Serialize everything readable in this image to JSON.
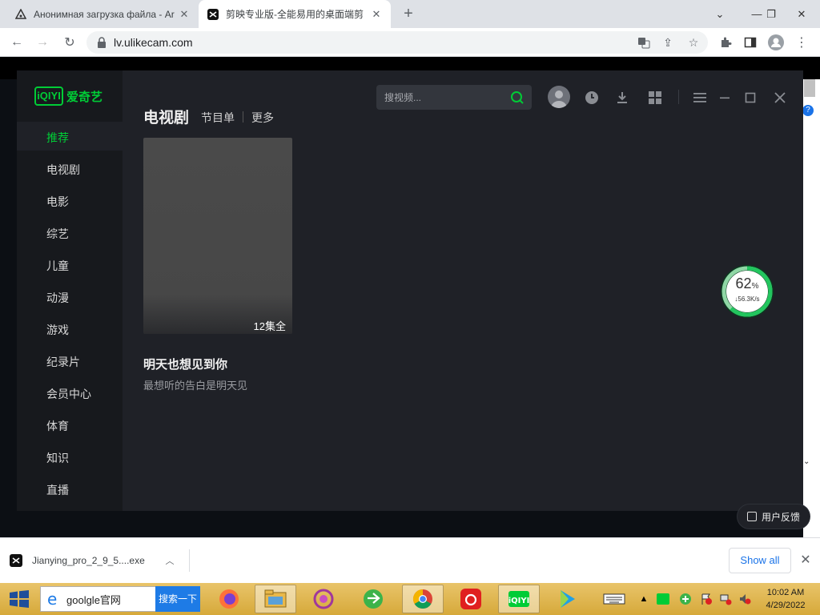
{
  "browser": {
    "tabs": [
      {
        "title": "Анонимная загрузка файла - Ar",
        "active": false
      },
      {
        "title": "剪映专业版-全能易用的桌面端剪",
        "active": true
      }
    ],
    "url": "lv.ulikecam.com"
  },
  "app": {
    "name": "爱奇艺",
    "logo_text": "iQIYI",
    "search_placeholder": "搜视频...",
    "nav": [
      "推荐",
      "电视剧",
      "电影",
      "综艺",
      "儿童",
      "动漫",
      "游戏",
      "纪录片",
      "会员中心",
      "体育",
      "知识",
      "直播"
    ],
    "active_nav": "推荐",
    "section": {
      "title": "电视剧",
      "links": [
        "节目单",
        "更多"
      ]
    },
    "card": {
      "title": "明天也想见到你",
      "subtitle": "最想听的告白是明天见",
      "episode_badge": "12集全"
    }
  },
  "speed_widget": {
    "percent": "62",
    "percent_sign": "%",
    "rate": "↓56.3K/s",
    "fraction": 0.62
  },
  "feedback": {
    "label": "用户反馈"
  },
  "download_bar": {
    "file": "Jianying_pro_2_9_5....exe",
    "show_all": "Show all"
  },
  "taskbar": {
    "search_text": "goolgle官网",
    "search_button": "搜索一下",
    "time": "10:02 AM",
    "date": "4/29/2022"
  },
  "colors": {
    "accent": "#00cc36",
    "app_bg": "#1f2127",
    "sidebar_bg": "#17191d",
    "chrome_blue": "#1a73e8"
  }
}
